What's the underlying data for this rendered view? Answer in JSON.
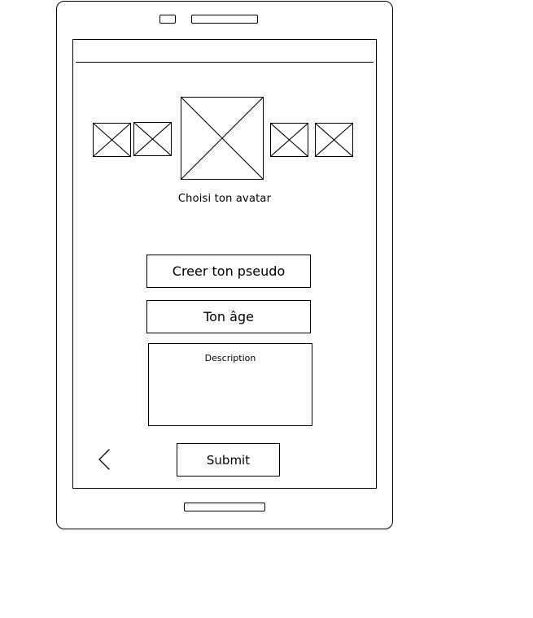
{
  "avatar_picker": {
    "label": "Choisi ton avatar",
    "options": [
      "avatar-1",
      "avatar-2",
      "avatar-3",
      "avatar-4",
      "avatar-5"
    ],
    "selected_index": 2
  },
  "form": {
    "pseudo_placeholder": "Creer ton pseudo",
    "age_placeholder": "Ton âge",
    "description_placeholder": "Description",
    "submit_label": "Submit"
  },
  "icons": {
    "back": "chevron-left-icon",
    "avatar_placeholder": "image-placeholder-icon"
  },
  "colors": {
    "stroke": "#000000",
    "background": "#ffffff"
  }
}
